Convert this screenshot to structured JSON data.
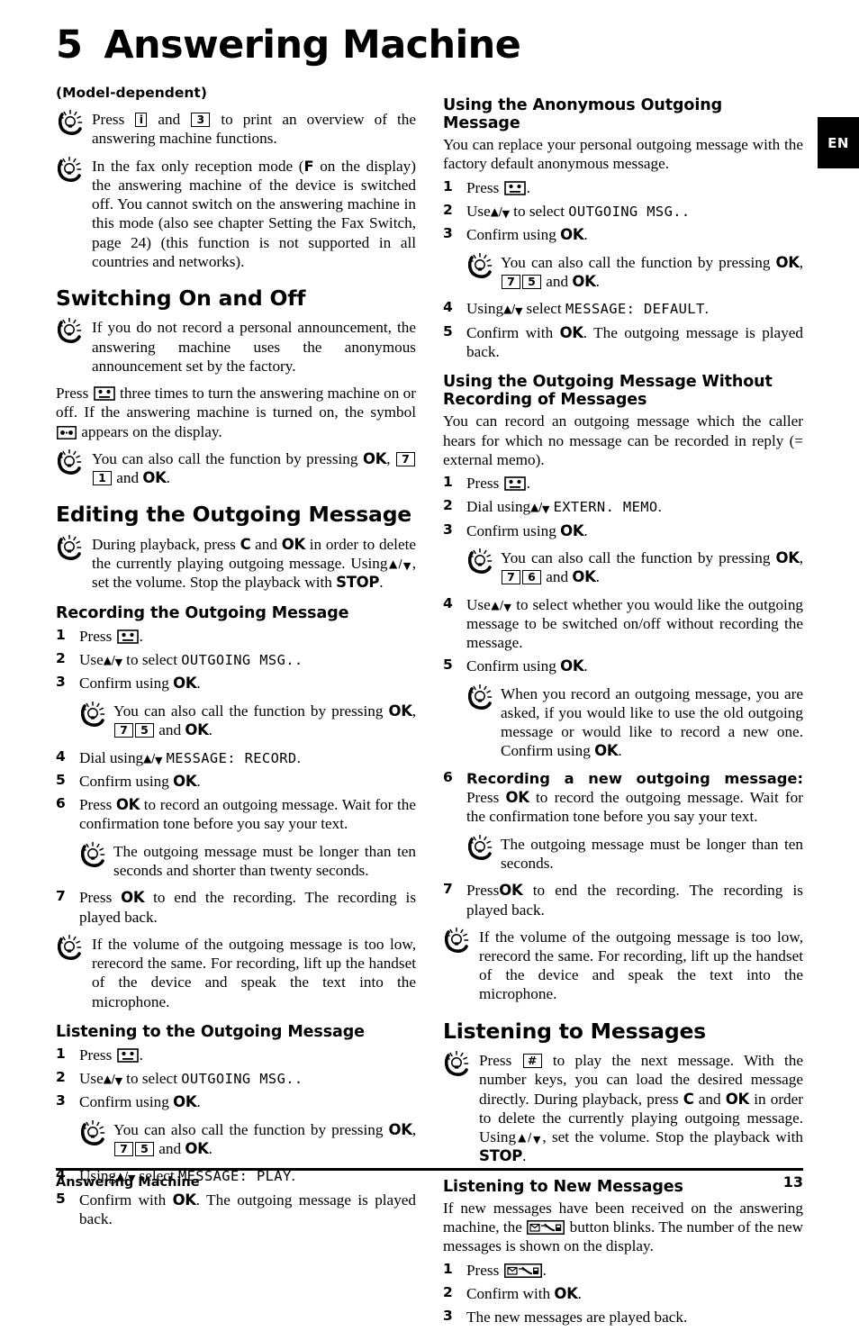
{
  "page": {
    "chapter_number": "5",
    "chapter_title": "Answering Machine",
    "language_tab": "EN",
    "footer_left": "Answering Machine",
    "footer_page_number": "13",
    "model_dependent": "(Model-dependent)"
  },
  "icons": {
    "tip": "lightbulb-hand-tip-icon",
    "cassette": "answering-machine-cassette-icon",
    "display_symbol": "display-cassette-symbol-icon",
    "new_message_button": "new-message-button-icon"
  },
  "left_column": {
    "tip_print_overview": {
      "part1": "Press",
      "key1": "i",
      "part2": "and",
      "key2": "3",
      "part3": "to print an overview of the answering machine functions."
    },
    "tip_fax_only": {
      "part1": "In the fax only reception mode (",
      "bold1": "F",
      "part2": " on the display) the answering machine of the device is switched off. You cannot switch on the answering machine in this mode (also see chapter Setting the Fax Switch, page 24) (this function is not supported in all countries and networks)."
    },
    "heading_switching": "Switching On and Off",
    "tip_personal_announcement": "If you do not record a personal announcement, the answering machine uses the anonymous announcement set by the factory.",
    "para_press_three_times": {
      "part1": "Press",
      "part2": "three times to turn the answering machine on or off. If the answering machine is turned on, the symbol",
      "part3": "appears on the display."
    },
    "tip_function_71": {
      "part1": "You can also call the function by pressing",
      "ok1": "OK",
      "comma": ",",
      "key1": "7",
      "key2": "1",
      "part2": "and",
      "ok2": "OK",
      "period": "."
    },
    "heading_editing": "Editing the Outgoing Message",
    "tip_during_playback": {
      "part1": "During playback, press",
      "c": "C",
      "part2": "and",
      "ok": "OK",
      "part3": "in order to delete the currently playing outgoing message. Using",
      "part4": ", set the volume. Stop the playback with",
      "stop": "STOP",
      "period": "."
    },
    "heading_recording": "Recording the Outgoing Message",
    "steps_recording": [
      {
        "n": "1",
        "text": "Press",
        "icon": "cassette",
        "after": "."
      },
      {
        "n": "2",
        "pre": "Use",
        "arrows": true,
        "mid": "to select",
        "lcd": "OUTGOING MSG..",
        "post": ""
      },
      {
        "n": "3",
        "pre": "Confirm using",
        "ok": "OK",
        "post": "."
      },
      {
        "n": "4",
        "pre": "Dial using",
        "arrows": true,
        "lcd": "MESSAGE: RECORD",
        "post": "."
      },
      {
        "n": "5",
        "pre": "Confirm using",
        "ok": "OK",
        "post": "."
      },
      {
        "n": "6",
        "pre": "Press",
        "ok": "OK",
        "post": "to record an outgoing message. Wait for the confirmation tone before you say your text."
      },
      {
        "n": "7",
        "pre": "Press",
        "ok": "OK",
        "post": "to end the recording. The recording is played back."
      }
    ],
    "tip_function_75_record": {
      "part1": "You can also call the function by pressing",
      "ok1": "OK",
      "comma": ",",
      "key1": "7",
      "key2": "5",
      "part2": "and",
      "ok2": "OK",
      "period": "."
    },
    "tip_length_ten_twenty": "The outgoing message must be longer than ten seconds and shorter than twenty seconds.",
    "tip_volume_too_low": "If the volume of the outgoing message is too low, rerecord the same. For recording, lift up the handset of the device and speak the text into the microphone.",
    "heading_listening_outgoing": "Listening to the Outgoing Message",
    "steps_listening": [
      {
        "n": "1",
        "text": "Press",
        "icon": "cassette",
        "after": "."
      },
      {
        "n": "2",
        "pre": "Use",
        "arrows": true,
        "mid": "to select",
        "lcd": "OUTGOING MSG..",
        "post": ""
      },
      {
        "n": "3",
        "pre": "Confirm using",
        "ok": "OK",
        "post": "."
      },
      {
        "n": "4",
        "pre": "Using",
        "arrows": true,
        "mid": "select",
        "lcd": "MESSAGE: PLAY",
        "post": "."
      },
      {
        "n": "5",
        "pre": "Confirm with",
        "ok": "OK",
        "post": ". The outgoing message is played back."
      }
    ]
  },
  "right_column": {
    "heading_anonymous": "Using the Anonymous Outgoing Message",
    "para_anonymous": "You can replace your personal outgoing message with the factory default anonymous message.",
    "steps_anonymous": [
      {
        "n": "1",
        "text": "Press",
        "icon": "cassette",
        "after": "."
      },
      {
        "n": "2",
        "pre": "Use",
        "arrows": true,
        "mid": "to select",
        "lcd": "OUTGOING MSG..",
        "post": ""
      },
      {
        "n": "3",
        "pre": "Confirm using",
        "ok": "OK",
        "post": "."
      },
      {
        "n": "4",
        "pre": "Using",
        "arrows": true,
        "mid": "select",
        "lcd": "MESSAGE: DEFAULT",
        "post": "."
      },
      {
        "n": "5",
        "pre": "Confirm with",
        "ok": "OK",
        "post": ". The outgoing message is played back."
      }
    ],
    "tip_function_75_anon": {
      "part1": "You can also call the function by pressing",
      "ok1": "OK",
      "comma": ",",
      "key1": "7",
      "key2": "5",
      "part2": "and",
      "ok2": "OK",
      "period": "."
    },
    "heading_without_recording": "Using the Outgoing Message Without Recording of Messages",
    "para_without_recording": "You can record an outgoing message which the caller hears for which no message can be recorded in reply (= external memo).",
    "steps_without_recording": [
      {
        "n": "1",
        "text": "Press",
        "icon": "cassette",
        "after": "."
      },
      {
        "n": "2",
        "pre": "Dial using",
        "arrows": true,
        "lcd": "EXTERN. MEMO",
        "post": "."
      },
      {
        "n": "3",
        "pre": "Confirm using",
        "ok": "OK",
        "post": "."
      },
      {
        "n": "4",
        "pre": "Use",
        "arrows": true,
        "mid": "to select whether you would like the outgoing message to be switched on/off without recording the message.",
        "post": ""
      },
      {
        "n": "5",
        "pre": "Confirm using",
        "ok": "OK",
        "post": "."
      }
    ],
    "tip_function_76": {
      "part1": "You can also call the function by pressing",
      "ok1": "OK",
      "comma": ",",
      "key1": "7",
      "key2": "6",
      "part2": "and",
      "ok2": "OK",
      "period": "."
    },
    "tip_when_you_record": {
      "part1": "When you record an outgoing message, you are asked, if you would like to use the old outgoing message or would like to record a new one. Confirm using",
      "ok": "OK",
      "period": "."
    },
    "step6_recording_new": {
      "n": "6",
      "bold_lead": "Recording a new outgoing message:",
      "pre": "Press",
      "ok": "OK",
      "post": "to record the outgoing message. Wait for the confirmation tone before you say your text."
    },
    "tip_length_ten": "The outgoing message must be longer than ten seconds.",
    "step7_end_recording": {
      "n": "7",
      "pre": "Press",
      "ok": "OK",
      "post": "to end the recording. The recording is played back."
    },
    "tip_volume_too_low": "If the volume of the outgoing message is too low, rerecord the same. For recording, lift up the handset of the device and speak the text into the microphone.",
    "heading_listening_messages": "Listening to Messages",
    "tip_press_hash": {
      "part1": "Press",
      "key": "#",
      "part2": "to play the next message. With the number keys, you can load the desired message directly. During playback, press",
      "c": "C",
      "part3": "and",
      "ok": "OK",
      "part4": "in order to delete the currently playing outgoing message. Using",
      "part5": ", set the volume. Stop the playback with",
      "stop": "STOP",
      "period": "."
    },
    "heading_listening_new": "Listening to New Messages",
    "para_new_messages": {
      "part1": "If new messages have been received on the answering machine, the",
      "part2": "button blinks. The number of the new messages is shown on the display."
    },
    "steps_new_messages": [
      {
        "n": "1",
        "text": "Press",
        "icon": "new_message_button",
        "after": "."
      },
      {
        "n": "2",
        "pre": "Confirm with",
        "ok": "OK",
        "post": "."
      },
      {
        "n": "3",
        "pre": "The new messages are played back.",
        "post": ""
      }
    ]
  }
}
